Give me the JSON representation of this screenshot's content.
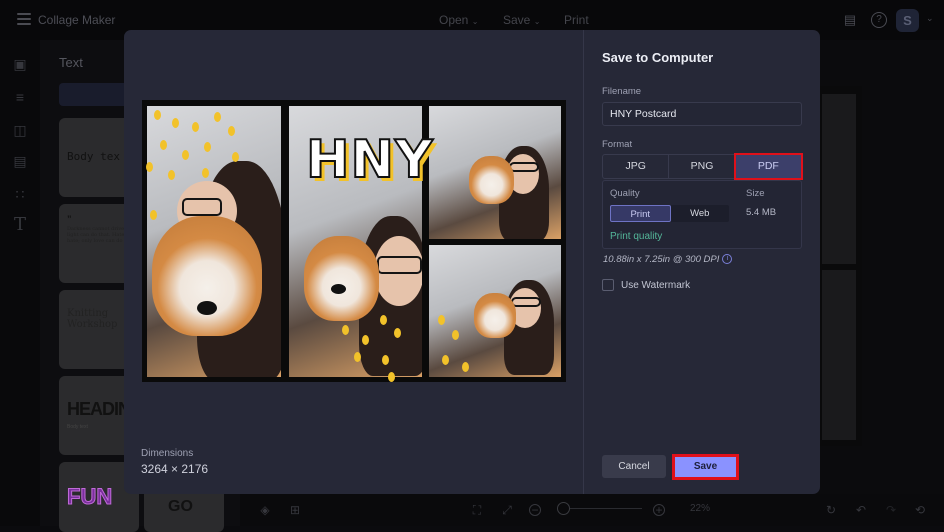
{
  "app": {
    "title": "Collage Maker",
    "menu": [
      {
        "label": "Open",
        "chevron": "chevron-down-icon"
      },
      {
        "label": "Save",
        "chevron": "chevron-down-icon"
      },
      {
        "label": "Print"
      }
    ],
    "user_initial": "S"
  },
  "sidebar": {
    "icons": [
      "layout-icon",
      "sliders-icon",
      "grid-layout-icon",
      "table-icon",
      "apps-icon",
      "text-icon"
    ],
    "panel_title": "Text",
    "cards": [
      {
        "kind": "body",
        "text": "Body tex"
      },
      {
        "kind": "quote",
        "text": "Darkness cannot drive out darkness; only light can do that. Hate cannot drive out hate; only love can do that."
      },
      {
        "kind": "knitting",
        "title": "Knitting Workshop"
      },
      {
        "kind": "heading",
        "title": "HEADING",
        "sub": "Body text"
      },
      {
        "kind": "fun",
        "title": "FUN"
      },
      {
        "kind": "go",
        "title": "GO"
      }
    ]
  },
  "dialog": {
    "title": "Save to Computer",
    "preview_text": "HNY",
    "dimensions_label": "Dimensions",
    "dimensions_value": "3264 × 2176",
    "filename_label": "Filename",
    "filename_value": "HNY Postcard",
    "format_label": "Format",
    "formats": [
      "JPG",
      "PNG",
      "PDF"
    ],
    "selected_format": "PDF",
    "quality_label": "Quality",
    "quality_options": [
      "Print",
      "Web"
    ],
    "selected_quality": "Print",
    "quality_note": "Print quality",
    "size_label": "Size",
    "size_value": "5.4 MB",
    "dpi_text": "10.88in x 7.25in @ 300 DPI",
    "watermark_label": "Use Watermark",
    "watermark_checked": false,
    "cancel_label": "Cancel",
    "save_label": "Save"
  },
  "bottombar": {
    "zoom_value": "22%"
  },
  "colors": {
    "accent": "#8a92ff",
    "highlight": "#e0101a",
    "quality_note": "#54b79a",
    "selected_segment": "#3c3f6a"
  }
}
